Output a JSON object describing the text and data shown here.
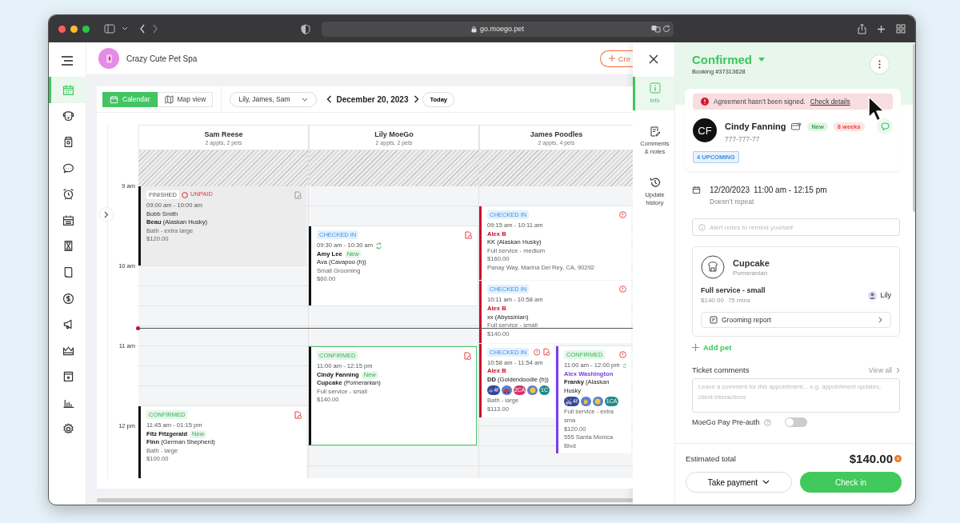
{
  "browser": {
    "url": "go.moego.pet"
  },
  "sidebar": {
    "items": [
      {
        "selected": true
      },
      {
        "selected": false
      },
      {
        "selected": false
      },
      {
        "selected": false
      },
      {
        "selected": false
      },
      {
        "selected": false
      },
      {
        "selected": false
      },
      {
        "selected": false
      },
      {
        "selected": false
      },
      {
        "selected": false
      },
      {
        "selected": false
      },
      {
        "selected": false
      },
      {
        "selected": false
      },
      {
        "selected": false
      }
    ]
  },
  "header": {
    "business_name": "Crazy Cute Pet Spa",
    "create_button": "Cre"
  },
  "toolbar": {
    "view_tabs": [
      {
        "label": "Calendar",
        "selected": true
      },
      {
        "label": "Map view",
        "selected": false
      }
    ],
    "staff_filter": "Lily, James, Sam",
    "date": "December 20, 2023",
    "today_button": "Today"
  },
  "calendar": {
    "time_labels": [
      "9 am",
      "10 am",
      "11 am",
      "12 pm"
    ],
    "columns": [
      {
        "name": "Sam Reese",
        "summary": "2 appts, 2 pets",
        "appointments": [
          {
            "status": "FINISHED",
            "kind": "finished",
            "payment": "UNPAID",
            "time": "09:00 am - 10:00 am",
            "client": "Bobb Smith",
            "pet": "**Beau** (Alaskan Husky)",
            "service": "Bath - extra large",
            "price": "$120.00",
            "color": "#111111",
            "selected": false,
            "agreement_icon": true,
            "alert_icon": false,
            "recurring": false
          },
          {
            "status": "CONFIRMED",
            "kind": "confirmed",
            "time": "11:45 am - 01:15 pm",
            "client": "Fitz Fitzgerald",
            "client_badge": "New",
            "pet": "**Finn** (German Shepherd)",
            "service": "Bath - large",
            "price": "$100.00",
            "color": "#111111",
            "selected": false,
            "agreement_icon": true,
            "alert_icon": false,
            "recurring": false
          }
        ]
      },
      {
        "name": "Lily MoeGo",
        "summary": "2 appts, 2 pets",
        "appointments": [
          {
            "status": "CHECKED IN",
            "kind": "checked_in",
            "time": "09:30 am - 10:30 am",
            "client": "Amy Lee",
            "client_badge": "New",
            "pet": "Ava (Cavapoo (h))",
            "service": "Small Grooming",
            "price": "$60.00",
            "color": "#111111",
            "selected": false,
            "agreement_icon": true,
            "alert_icon": false,
            "recurring": true
          },
          {
            "status": "CONFIRMED",
            "kind": "confirmed",
            "time": "11:00 am - 12:15 pm",
            "client": "Cindy Fanning",
            "client_badge": "New",
            "pet": "**Cupcake** (Pomeranian)",
            "service": "Full service - small",
            "price": "$140.00",
            "color": "#111111",
            "selected": true,
            "agreement_icon": true,
            "alert_icon": false,
            "recurring": false
          }
        ]
      },
      {
        "name": "James Poodles",
        "summary": "2 appts, 4 pets",
        "appointments": [
          {
            "status": "CHECKED IN",
            "kind": "checked_in",
            "time": "09:15 am - 10:11 am",
            "client": "Alex B",
            "pet": "KK (Alaskan Husky)",
            "service": "Full service - medium",
            "price": "$160.00",
            "address": "Panay Way, Marina Del Rey, CA, 90292",
            "color": "#c8102e",
            "selected": false,
            "agreement_icon": false,
            "alert_icon": true,
            "recurring": false
          },
          {
            "status": "CHECKED IN",
            "kind": "checked_in",
            "time": "10:11 am - 10:58 am",
            "client": "Alex B",
            "pet": "xx (Abyssinian)",
            "service": "Full service - small",
            "price": "$140.00",
            "color": "#c8102e",
            "selected": false,
            "agreement_icon": false,
            "alert_icon": true,
            "recurring": false
          },
          {
            "status": "CHECKED IN",
            "kind": "checked_in",
            "time": "10:58 am - 11:54 am",
            "client": "Alex B",
            "pet": "**DD** (Goldendoodle (h))",
            "tags": [
              {
                "kind": "scissors",
                "label": "4f",
                "color": "#34469b"
              },
              {
                "kind": "car",
                "color": "#5b7fd6"
              },
              {
                "kind": "text",
                "label": "2CA",
                "color": "#d9336c"
              },
              {
                "kind": "emoji",
                "color": "#5b7fd6"
              },
              {
                "kind": "text",
                "label": "1C",
                "color": "#1f8a8a"
              }
            ],
            "service": "Bath - large",
            "price": "$113.00",
            "color": "#c8102e",
            "selected": false,
            "agreement_icon": true,
            "alert_icon": true,
            "recurring": false
          },
          {
            "status": "CONFIRMED",
            "kind": "confirmed",
            "time": "11:00 am - 12:00 pm",
            "client": "Alex Washington",
            "pet": "**Franky** (Alaskan Husky",
            "tags": [
              {
                "kind": "scissors",
                "label": "4f",
                "color": "#34469b"
              },
              {
                "kind": "hand",
                "color": "#5b7fd6"
              },
              {
                "kind": "emoji",
                "color": "#5b7fd6"
              },
              {
                "kind": "text",
                "label": "1CA",
                "color": "#1f8a8a"
              }
            ],
            "service": "Full service - extra sma",
            "price": "$120.00",
            "address": "555 Santa Monica Blvd",
            "color": "#7b3fe4",
            "selected": false,
            "agreement_icon": false,
            "alert_icon": true,
            "recurring": true
          }
        ]
      }
    ]
  },
  "panel": {
    "nav": [
      {
        "label": "Info",
        "selected": true
      },
      {
        "label": "Comments & notes",
        "selected": false
      },
      {
        "label": "Update history",
        "selected": false
      }
    ],
    "status": "Confirmed",
    "booking": "Booking #37313628",
    "alert": {
      "text": "Agreement hasn’t been signed.",
      "link": "Check details"
    },
    "client": {
      "initials": "CF",
      "name": "Cindy Fanning",
      "badges": [
        {
          "label": "New",
          "color": "#2fa84f"
        },
        {
          "label": "8 weeks",
          "color": "#e8473a"
        }
      ],
      "phone": "777-777-77",
      "upcoming": "4 UPCOMING"
    },
    "schedule": {
      "date": "12/20/2023",
      "time": "11:00 am - 12:15 pm",
      "repeat": "Doesn’t repeat"
    },
    "alert_notes": {
      "placeholder": "Alert notes to remind yourself"
    },
    "pet": {
      "name": "Cupcake",
      "breed": "Pomeranian",
      "service": "Full service - small",
      "price": "$140.00",
      "duration": "75 mins",
      "staff": "Lily",
      "report": "Grooming report"
    },
    "add_pet": "Add pet",
    "comments": {
      "title": "Ticket comments",
      "view_all": "View all",
      "placeholder": "Leave a comment for this appointment... e.g. appointment updates, client interactions"
    },
    "preauth": {
      "label": "MoeGo Pay Pre-auth",
      "on": false
    },
    "footer": {
      "total_label": "Estimated total",
      "total": "$140.00",
      "take_payment": "Take payment",
      "check_in": "Check in"
    }
  }
}
